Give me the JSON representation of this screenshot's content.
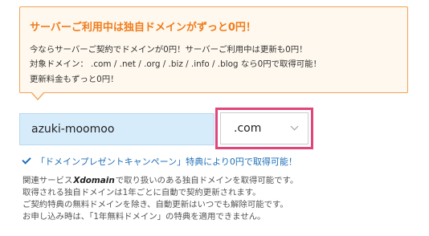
{
  "promo": {
    "title": "サーバーご利用中は独自ドメインがずっと0円！",
    "line1": "今ならサーバーご契約でドメインが0円！サーバーご利用中は更新も0円！",
    "line2": "対象ドメイン： .com / .net / .org / .biz / .info / .blog なら0円で取得可能！",
    "line3": "更新料金もずっと0円！"
  },
  "domain_input": {
    "value": "azuki-moomoo"
  },
  "tld_select": {
    "selected": ".com"
  },
  "campaign": {
    "text": "「ドメインプレゼントキャンペーン」特典により0円で取得可能！"
  },
  "info": {
    "line1_prefix": "関連サービス",
    "logo_text": "Xdomain",
    "line1_suffix": "で取り扱いのある独自ドメインを取得可能です。",
    "line2": "取得される独自ドメインは1年ごとに自動で契約更新されます。",
    "line3": "ご契約特典の無料ドメインを除き、自動更新はいつでも解除可能です。",
    "line4": "お申し込み時は、「1年無料ドメイン」の特典を適用できません。"
  },
  "colors": {
    "accent_orange": "#f07c1c",
    "highlight_pink": "#e0457b",
    "link_blue": "#1f6fb7",
    "input_bg": "#d6ecfb"
  }
}
